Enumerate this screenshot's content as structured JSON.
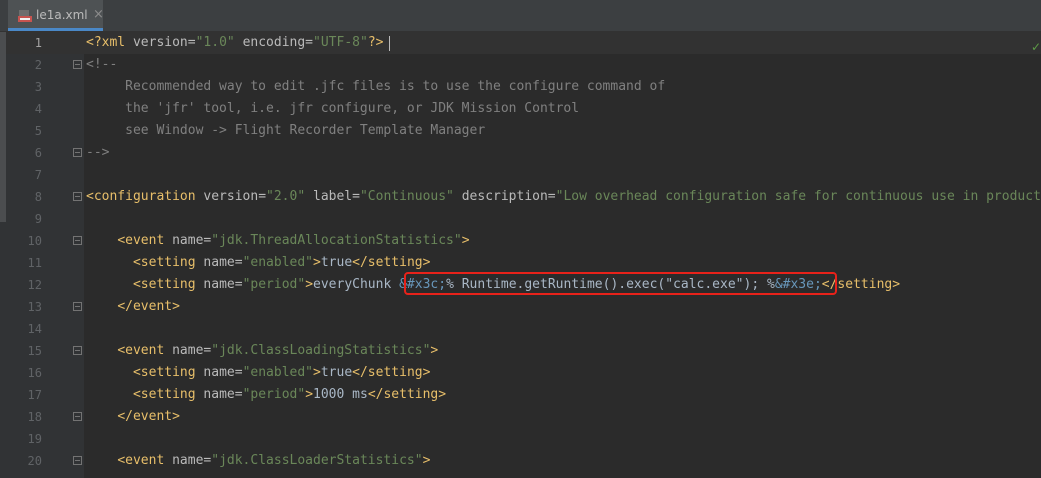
{
  "tab": {
    "label": "le1a.xml",
    "close": "×"
  },
  "status": {
    "check": "✓"
  },
  "lines": [
    {
      "num": "1",
      "current": true,
      "tokens": [
        {
          "c": "tag",
          "t": "<?xml "
        },
        {
          "c": "attr",
          "t": "version="
        },
        {
          "c": "val",
          "t": "\"1.0\" "
        },
        {
          "c": "attr",
          "t": "encoding="
        },
        {
          "c": "val",
          "t": "\"UTF-8\""
        },
        {
          "c": "tag",
          "t": "?>"
        }
      ]
    },
    {
      "num": "2",
      "fold": true,
      "tokens": [
        {
          "c": "cmt",
          "t": "<!--"
        }
      ]
    },
    {
      "num": "3",
      "tokens": [
        {
          "c": "cmt",
          "t": "     Recommended way to edit .jfc files is to use the configure command of"
        }
      ]
    },
    {
      "num": "4",
      "tokens": [
        {
          "c": "cmt",
          "t": "     the 'jfr' tool, i.e. jfr configure, or JDK Mission Control"
        }
      ]
    },
    {
      "num": "5",
      "tokens": [
        {
          "c": "cmt",
          "t": "     see Window -> Flight Recorder Template Manager"
        }
      ]
    },
    {
      "num": "6",
      "fold": true,
      "tokens": [
        {
          "c": "cmt",
          "t": "-->"
        }
      ]
    },
    {
      "num": "7",
      "tokens": []
    },
    {
      "num": "8",
      "fold": true,
      "tokens": [
        {
          "c": "tag",
          "t": "<configuration "
        },
        {
          "c": "attr",
          "t": "version="
        },
        {
          "c": "val",
          "t": "\"2.0\" "
        },
        {
          "c": "attr",
          "t": "label="
        },
        {
          "c": "val",
          "t": "\"Continuous\" "
        },
        {
          "c": "attr",
          "t": "description="
        },
        {
          "c": "val",
          "t": "\"Low overhead configuration safe for continuous use in production"
        }
      ]
    },
    {
      "num": "9",
      "tokens": []
    },
    {
      "num": "10",
      "fold": true,
      "tokens": [
        {
          "c": "txt",
          "t": "    "
        },
        {
          "c": "tag",
          "t": "<event "
        },
        {
          "c": "attr",
          "t": "name="
        },
        {
          "c": "val",
          "t": "\"jdk.ThreadAllocationStatistics\""
        },
        {
          "c": "tag",
          "t": ">"
        }
      ]
    },
    {
      "num": "11",
      "tokens": [
        {
          "c": "txt",
          "t": "      "
        },
        {
          "c": "tag",
          "t": "<setting "
        },
        {
          "c": "attr",
          "t": "name="
        },
        {
          "c": "val",
          "t": "\"enabled\""
        },
        {
          "c": "tag",
          "t": ">"
        },
        {
          "c": "txt",
          "t": "true"
        },
        {
          "c": "tag",
          "t": "</setting>"
        }
      ]
    },
    {
      "num": "12",
      "tokens": [
        {
          "c": "txt",
          "t": "      "
        },
        {
          "c": "tag",
          "t": "<setting "
        },
        {
          "c": "attr",
          "t": "name="
        },
        {
          "c": "val",
          "t": "\"period\""
        },
        {
          "c": "tag",
          "t": ">"
        },
        {
          "c": "txt",
          "t": "everyChunk "
        },
        {
          "c": "ent",
          "t": "&#x3c;"
        },
        {
          "c": "txt",
          "t": "% Runtime.getRuntime().exec(\"calc.exe\"); %"
        },
        {
          "c": "ent",
          "t": "&#x3e;"
        },
        {
          "c": "tag",
          "t": "</setting>"
        }
      ]
    },
    {
      "num": "13",
      "fold": true,
      "tokens": [
        {
          "c": "txt",
          "t": "    "
        },
        {
          "c": "tag",
          "t": "</event>"
        }
      ]
    },
    {
      "num": "14",
      "tokens": []
    },
    {
      "num": "15",
      "fold": true,
      "tokens": [
        {
          "c": "txt",
          "t": "    "
        },
        {
          "c": "tag",
          "t": "<event "
        },
        {
          "c": "attr",
          "t": "name="
        },
        {
          "c": "val",
          "t": "\"jdk.ClassLoadingStatistics\""
        },
        {
          "c": "tag",
          "t": ">"
        }
      ]
    },
    {
      "num": "16",
      "tokens": [
        {
          "c": "txt",
          "t": "      "
        },
        {
          "c": "tag",
          "t": "<setting "
        },
        {
          "c": "attr",
          "t": "name="
        },
        {
          "c": "val",
          "t": "\"enabled\""
        },
        {
          "c": "tag",
          "t": ">"
        },
        {
          "c": "txt",
          "t": "true"
        },
        {
          "c": "tag",
          "t": "</setting>"
        }
      ]
    },
    {
      "num": "17",
      "tokens": [
        {
          "c": "txt",
          "t": "      "
        },
        {
          "c": "tag",
          "t": "<setting "
        },
        {
          "c": "attr",
          "t": "name="
        },
        {
          "c": "val",
          "t": "\"period\""
        },
        {
          "c": "tag",
          "t": ">"
        },
        {
          "c": "txt",
          "t": "1000 ms"
        },
        {
          "c": "tag",
          "t": "</setting>"
        }
      ]
    },
    {
      "num": "18",
      "fold": true,
      "tokens": [
        {
          "c": "txt",
          "t": "    "
        },
        {
          "c": "tag",
          "t": "</event>"
        }
      ]
    },
    {
      "num": "19",
      "tokens": []
    },
    {
      "num": "20",
      "fold": true,
      "tokens": [
        {
          "c": "txt",
          "t": "    "
        },
        {
          "c": "tag",
          "t": "<event "
        },
        {
          "c": "attr",
          "t": "name="
        },
        {
          "c": "val",
          "t": "\"jdk.ClassLoaderStatistics\""
        },
        {
          "c": "tag",
          "t": ">"
        }
      ]
    }
  ]
}
